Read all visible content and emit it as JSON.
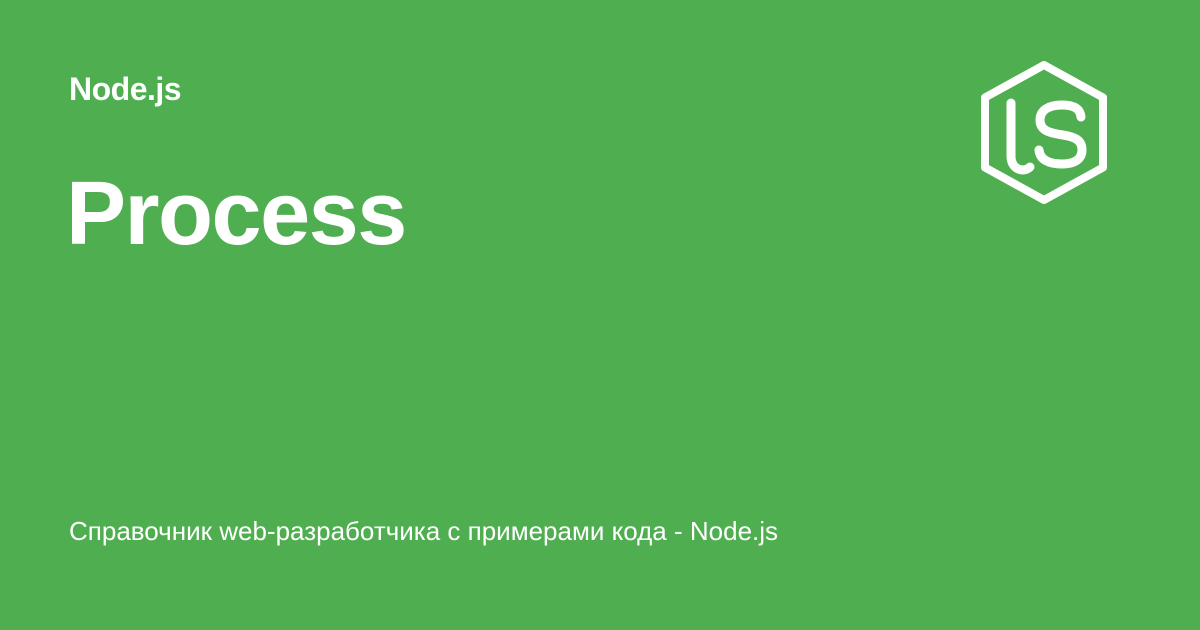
{
  "header": {
    "category": "Node.js"
  },
  "main": {
    "title": "Process"
  },
  "footer": {
    "subtitle": "Справочник web-разработчика с примерами кода - Node.js"
  },
  "logo": {
    "icon": "nodejs-hexagon-js-icon",
    "lettering": "JS"
  },
  "colors": {
    "background": "#4fae50",
    "foreground": "#ffffff"
  }
}
